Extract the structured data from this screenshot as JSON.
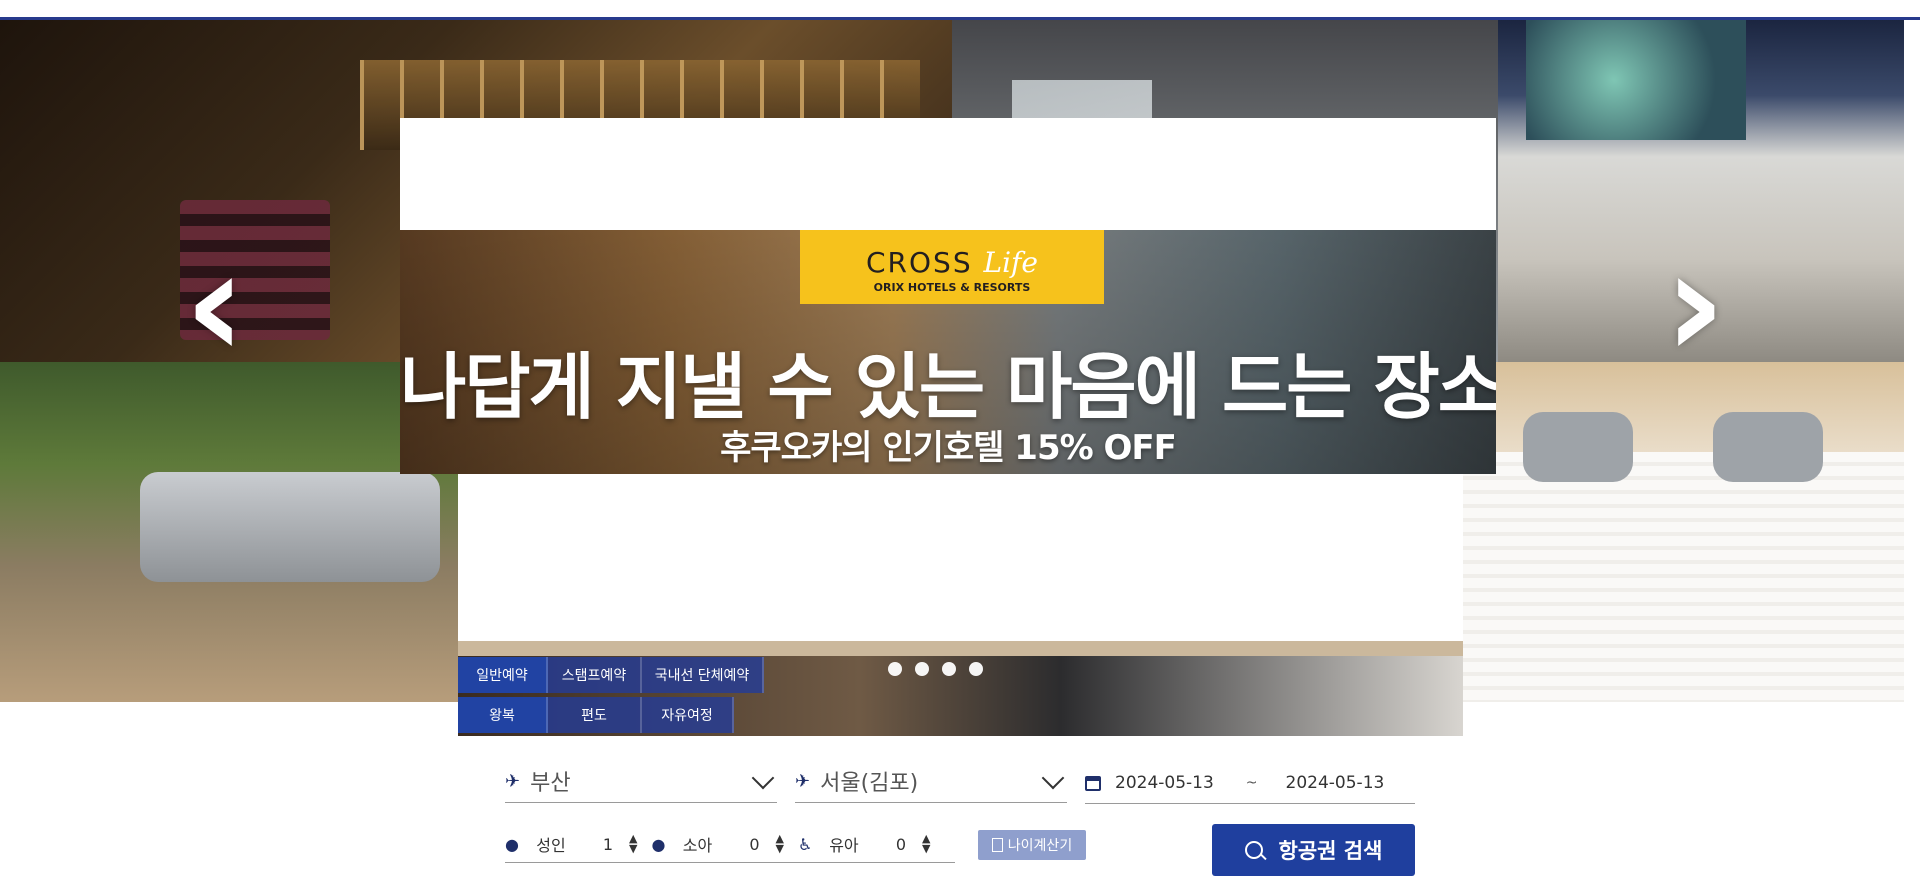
{
  "banner": {
    "logo_brand": "CROSS",
    "logo_brand_script": "Life",
    "logo_sub": "ORIX HOTELS & RESORTS",
    "headline": "나답게 지낼 수 있는 마음에 드는 장소",
    "subline": "후쿠오카의 인기호텔 15% OFF"
  },
  "carousel": {
    "prev_glyph": "‹",
    "next_glyph": "›",
    "dot_count": 4
  },
  "tabs": {
    "booking_types": [
      "일반예약",
      "스탬프예약",
      "국내선 단체예약"
    ],
    "trip_types": [
      "왕복",
      "편도",
      "자유여정"
    ]
  },
  "search": {
    "departure": "부산",
    "arrival": "서울(김포)",
    "date_from": "2024-05-13",
    "date_separator": "~",
    "date_to": "2024-05-13",
    "adult_label": "성인",
    "adult_count": "1",
    "child_label": "소아",
    "child_count": "0",
    "infant_label": "유아",
    "infant_count": "0",
    "age_calc_label": "나이계산기",
    "submit_label": "항공권 검색"
  },
  "colors": {
    "accent": "#1f3f9e",
    "tab_blue": "#2b4aa6",
    "logo_yellow": "#f6c21c",
    "age_button": "#8f9fcd"
  }
}
